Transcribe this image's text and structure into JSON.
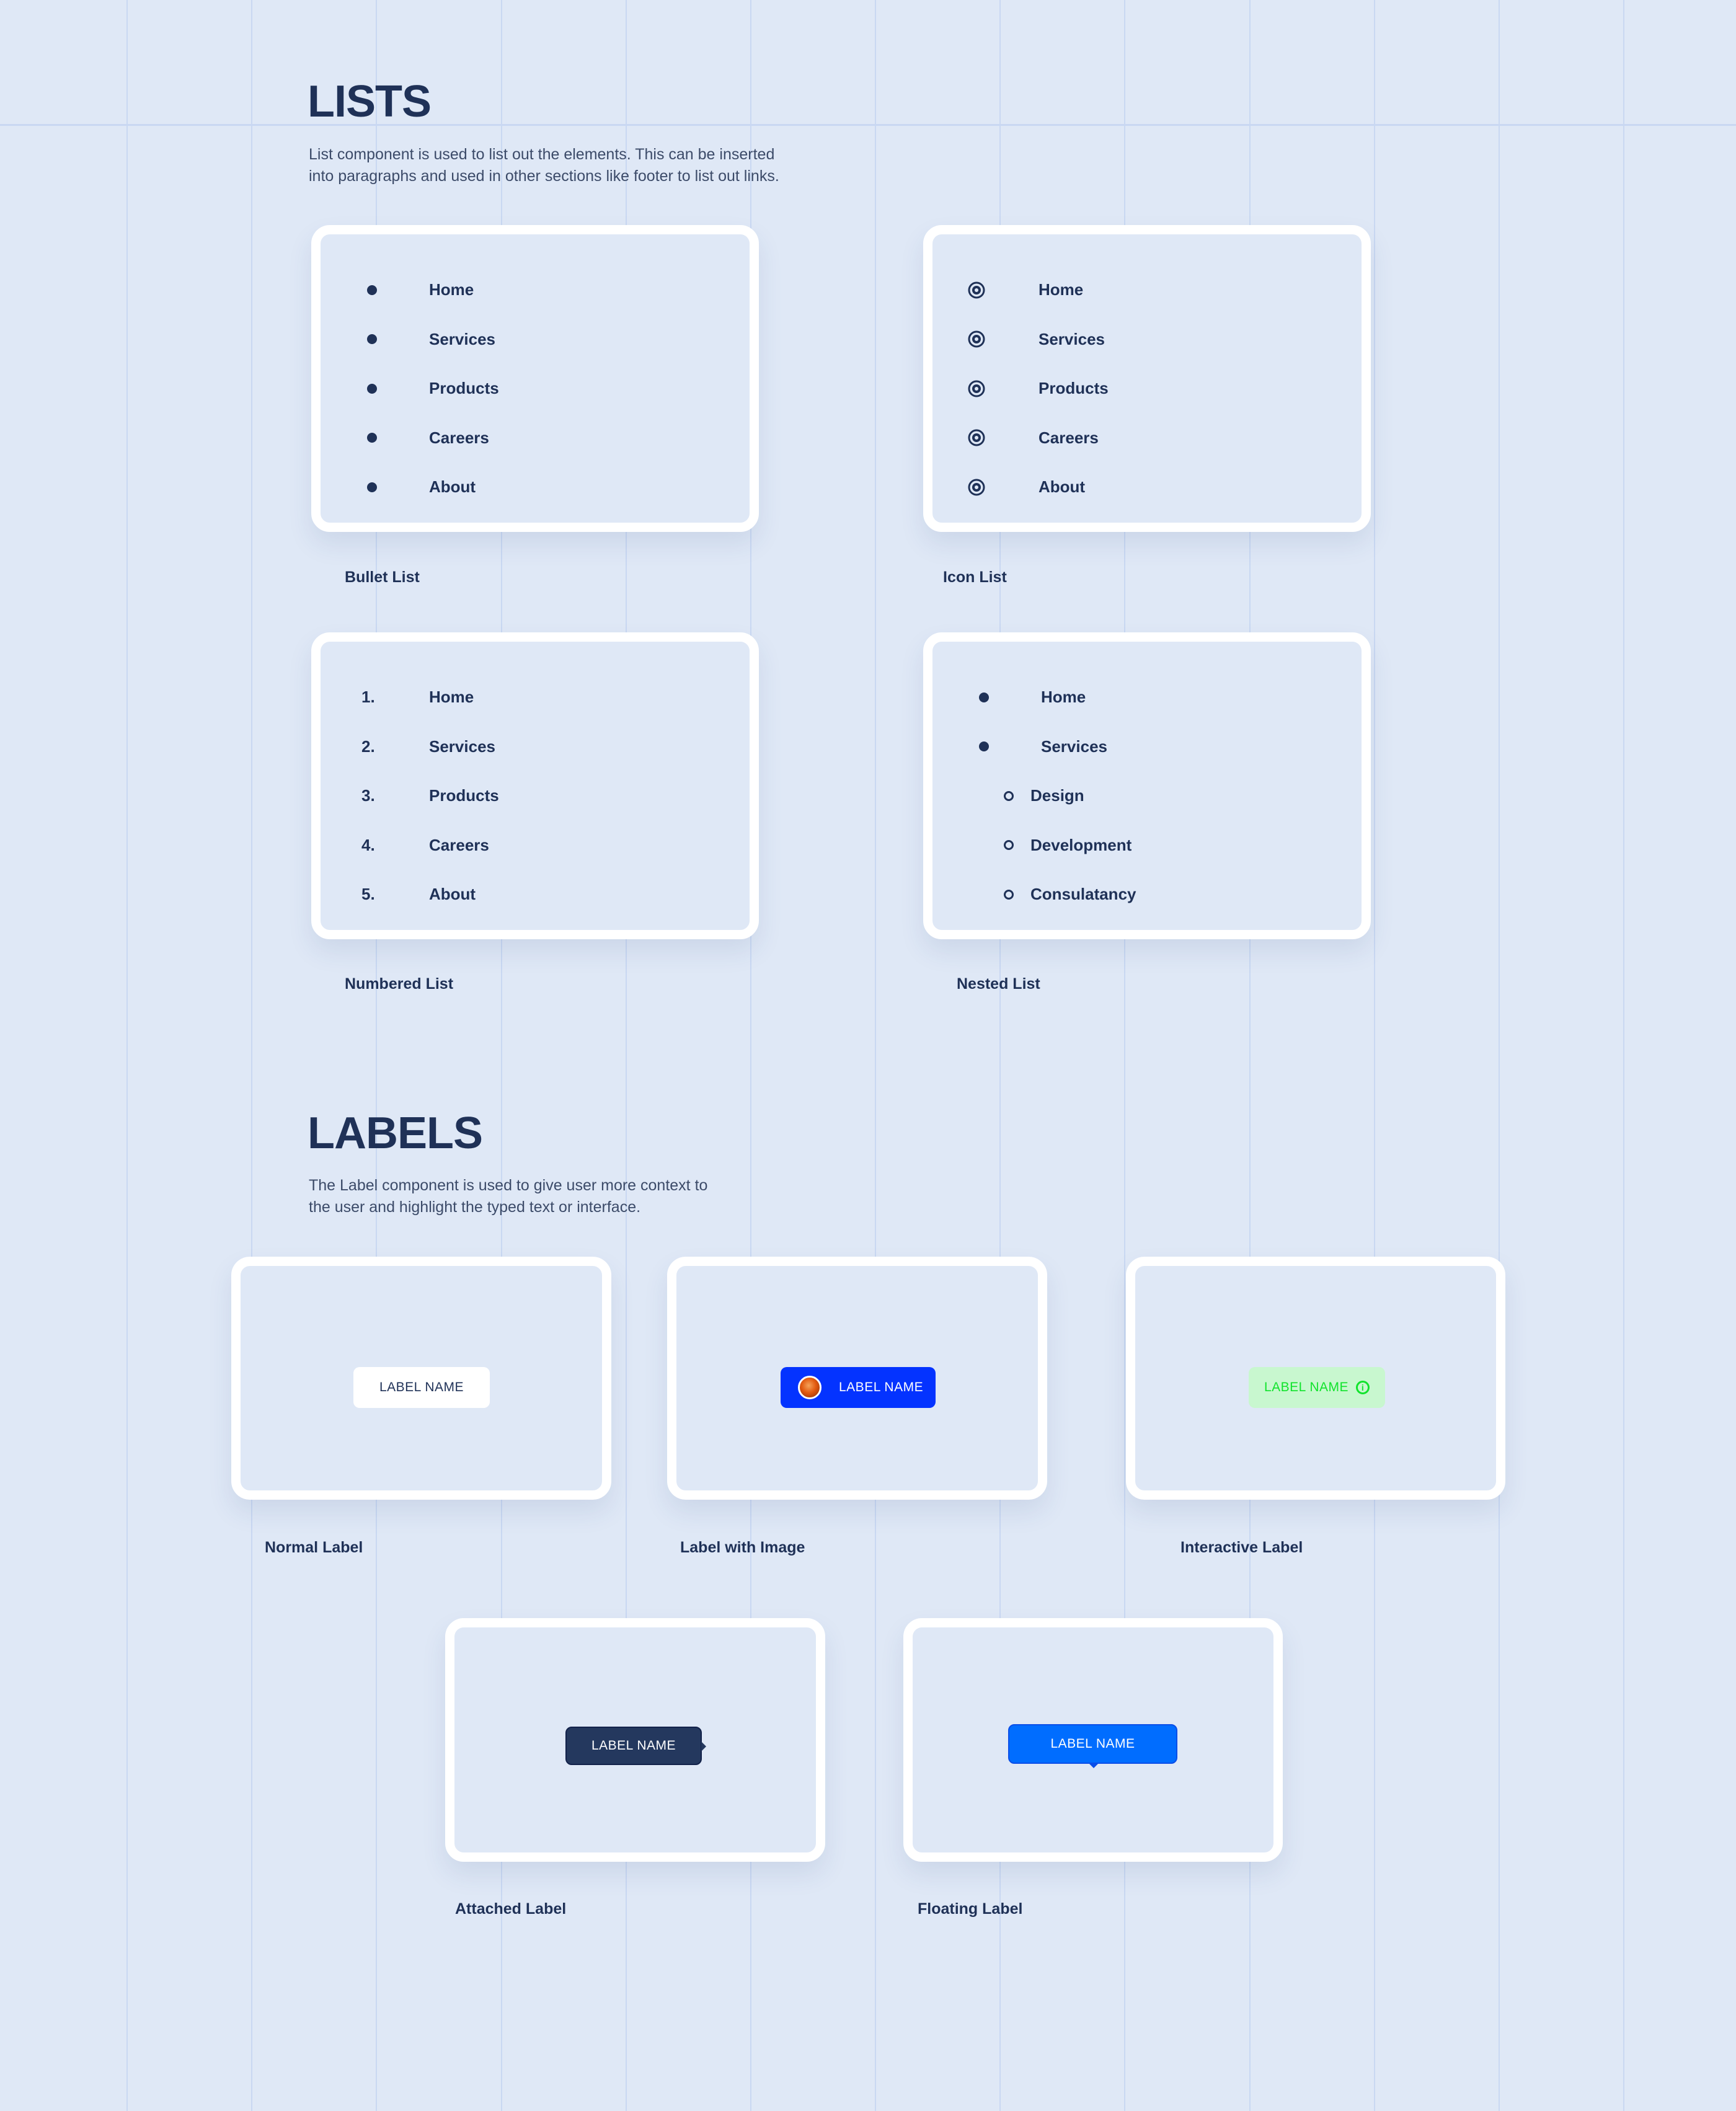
{
  "lists_section": {
    "title": "LISTS",
    "description_line1": "List component is used to list out the elements. This can be inserted",
    "description_line2": "into paragraphs and used in other sections like footer to list out links.",
    "bullet_list": {
      "caption": "Bullet List",
      "items": [
        "Home",
        "Services",
        "Products",
        "Careers",
        "About"
      ]
    },
    "icon_list": {
      "caption": "Icon List",
      "icon": "target-icon",
      "items": [
        "Home",
        "Services",
        "Products",
        "Careers",
        "About"
      ]
    },
    "numbered_list": {
      "caption": "Numbered List",
      "numbers": [
        "1.",
        "2.",
        "3.",
        "4.",
        "5."
      ],
      "items": [
        "Home",
        "Services",
        "Products",
        "Careers",
        "About"
      ]
    },
    "nested_list": {
      "caption": "Nested List",
      "items": [
        "Home",
        "Services"
      ],
      "sub_items": [
        "Design",
        "Development",
        "Consulatancy"
      ]
    }
  },
  "labels_section": {
    "title": "LABELS",
    "description_line1": "The Label component is used to give user more context to",
    "description_line2": "the user and highlight the typed text or interface.",
    "normal": {
      "caption": "Normal Label",
      "text": "LABEL NAME",
      "bg": "#ffffff",
      "fg": "#1f3157"
    },
    "with_image": {
      "caption": "Label with Image",
      "text": "LABEL NAME",
      "bg": "#0433ff",
      "fg": "#ffffff"
    },
    "interactive": {
      "caption": "Interactive Label",
      "text": "LABEL NAME",
      "icon": "info-icon",
      "bg": "#c8f7cf",
      "fg": "#11e32c"
    },
    "attached": {
      "caption": "Attached Label",
      "text": "LABEL NAME",
      "bg": "#24385e",
      "fg": "#ffffff"
    },
    "floating": {
      "caption": "Floating Label",
      "text": "LABEL NAME",
      "bg": "#006dff",
      "fg": "#ffffff"
    }
  },
  "colors": {
    "background": "#dfe8f6",
    "grid": "#c9d8f2",
    "text": "#1f3157",
    "card_border": "#ffffff"
  }
}
